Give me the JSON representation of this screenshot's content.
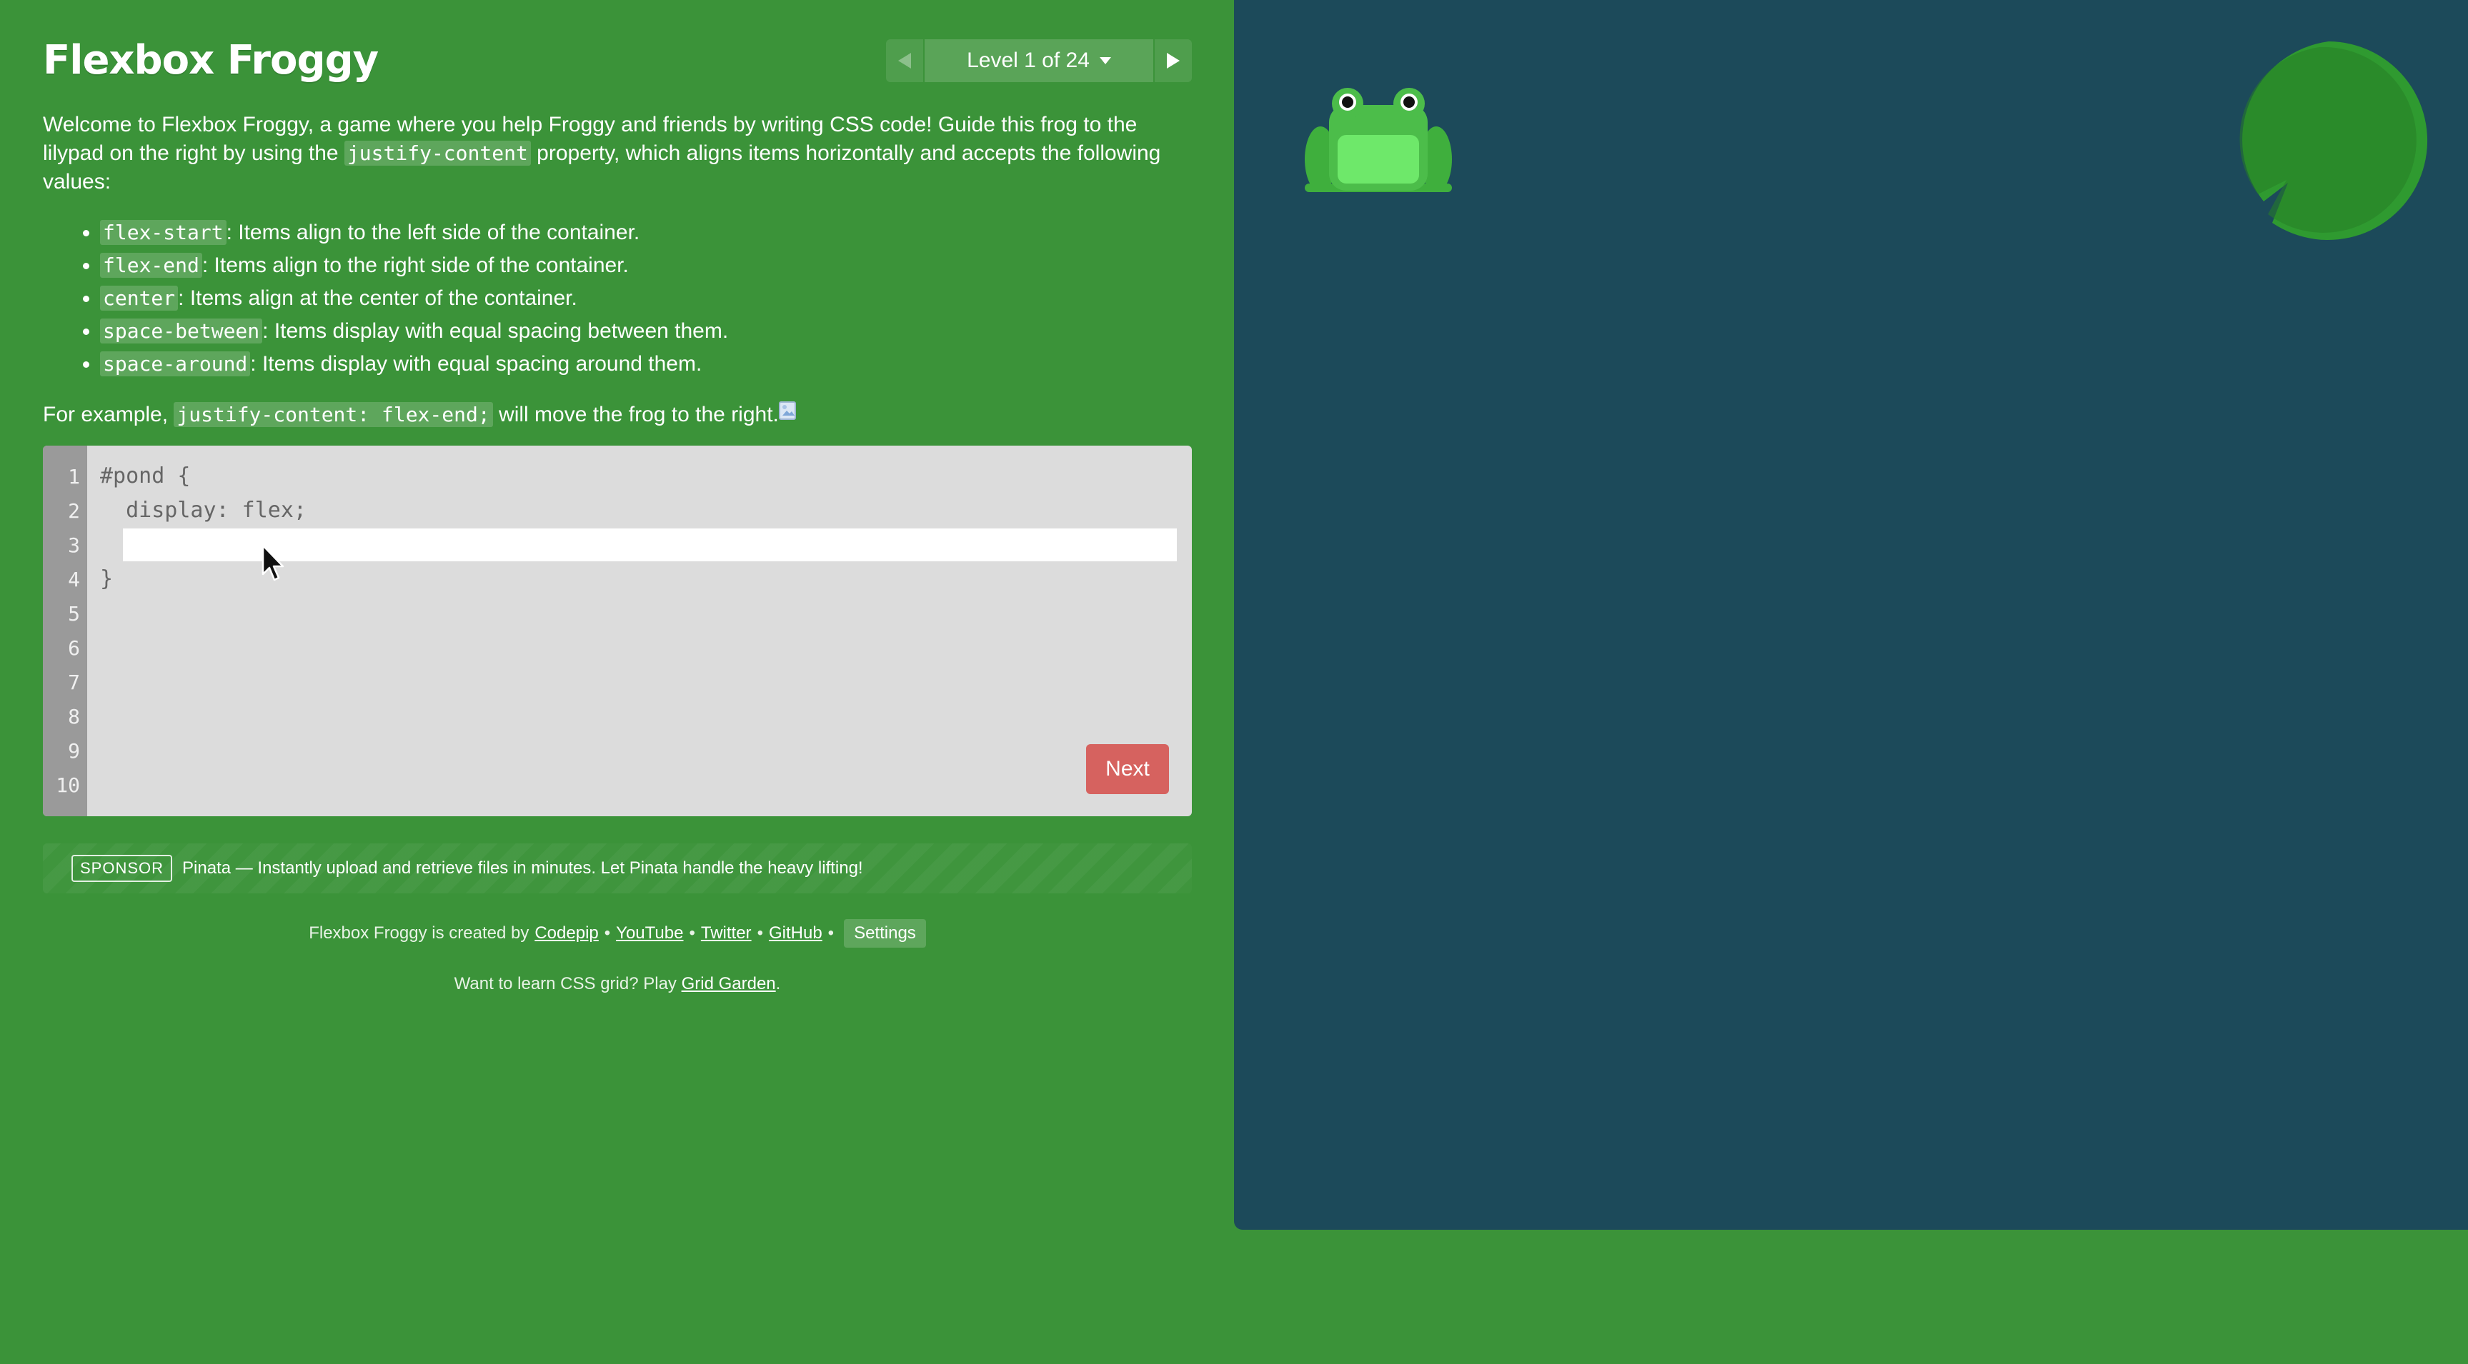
{
  "title": "Flexbox Froggy",
  "level_nav": {
    "label": "Level 1 of 24",
    "prev_icon": "triangle-left-icon",
    "next_icon": "triangle-right-icon",
    "caret_icon": "caret-down-icon"
  },
  "instructions": {
    "intro_before": "Welcome to Flexbox Froggy, a game where you help Froggy and friends by writing CSS code! Guide this frog to the lilypad on the right by using the ",
    "intro_code": "justify-content",
    "intro_after": " property, which aligns items horizontally and accepts the following values:",
    "values": [
      {
        "code": "flex-start",
        "desc": ": Items align to the left side of the container."
      },
      {
        "code": "flex-end",
        "desc": ": Items align to the right side of the container."
      },
      {
        "code": "center",
        "desc": ": Items align at the center of the container."
      },
      {
        "code": "space-between",
        "desc": ": Items display with equal spacing between them."
      },
      {
        "code": "space-around",
        "desc": ": Items display with equal spacing around them."
      }
    ],
    "example_before": "For example, ",
    "example_code": "justify-content: flex-end;",
    "example_after": " will move the frog to the right."
  },
  "editor": {
    "line_numbers": [
      "1",
      "2",
      "3",
      "4",
      "5",
      "6",
      "7",
      "8",
      "9",
      "10"
    ],
    "line1": "#pond {",
    "line2": "  display: flex;",
    "line4": "}",
    "input_value": "",
    "next_label": "Next"
  },
  "sponsor": {
    "badge": "SPONSOR",
    "text": "Pinata — Instantly upload and retrieve files in minutes. Let Pinata handle the heavy lifting!"
  },
  "footer": {
    "credits_prefix": "Flexbox Froggy is created by",
    "links": [
      "Codepip",
      "YouTube",
      "Twitter",
      "GitHub"
    ],
    "separator": "•",
    "settings_label": "Settings",
    "promo_before": "Want to learn CSS grid? Play ",
    "promo_link": "Grid Garden",
    "promo_after": "."
  },
  "colors": {
    "background": "#3b9339",
    "pond": "#1c4a5a",
    "next_button": "#d6625f",
    "frog": "#4cbd4a",
    "lilypad": "#2d8a2d"
  }
}
